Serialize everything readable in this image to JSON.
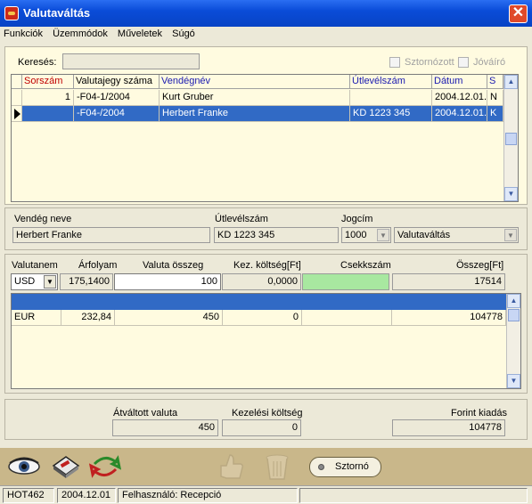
{
  "window": {
    "title": "Valutaváltás"
  },
  "menu": [
    "Funkciók",
    "Üzemmódok",
    "Műveletek",
    "Súgó"
  ],
  "search": {
    "label": "Keresés:",
    "value": "",
    "storno_label": "Sztornózott",
    "joviro_label": "Jóváíró"
  },
  "upper_table": {
    "headers": [
      "Sorszám",
      "Valutajegy száma",
      "Vendégnév",
      "Útlevélszám",
      "Dátum",
      "S"
    ],
    "rows": [
      [
        "1",
        "-F04-1/2004",
        "Kurt Gruber",
        "",
        "2004.12.01.",
        "N"
      ],
      [
        "",
        "-F04-/2004",
        "Herbert Franke",
        "KD 1223 345",
        "2004.12.01.",
        "K"
      ]
    ]
  },
  "guest": {
    "name_label": "Vendég neve",
    "name_value": "Herbert Franke",
    "passport_label": "Útlevélszám",
    "passport_value": "KD 1223 345",
    "jogcim_label": "Jogcím",
    "jogcim_code": "1000",
    "jogcim_value": "Valutaváltás"
  },
  "currency_form": {
    "headers": [
      "Valutanem",
      "Árfolyam",
      "Valuta összeg",
      "Kez. költség[Ft]",
      "Csekkszám",
      "Összeg[Ft]"
    ],
    "currency": "USD",
    "rate": "175,1400",
    "amount": "100",
    "fee": "0,0000",
    "check": "",
    "total": "17514"
  },
  "lower_table": {
    "rows": [
      [
        "EUR",
        "232,84",
        "450",
        "0",
        "",
        "104778"
      ]
    ]
  },
  "totals": {
    "converted_label": "Átváltott valuta",
    "converted_value": "450",
    "fee_label": "Kezelési költség",
    "fee_value": "0",
    "forint_label": "Forint kiadás",
    "forint_value": "104778"
  },
  "toolbar": {
    "storno_label": "Sztornó"
  },
  "status": {
    "hotel": "HOT462",
    "date": "2004.12.01",
    "user": "Felhasználó: Recepció"
  }
}
